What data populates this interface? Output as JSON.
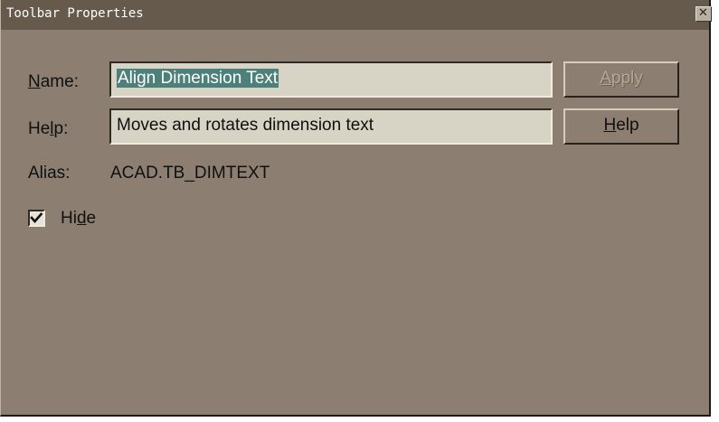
{
  "window": {
    "title": "Toolbar Properties",
    "close_glyph": "✕"
  },
  "form": {
    "name_label_accel": "N",
    "name_label_rest": "ame:",
    "name_value": "Align Dimension Text",
    "help_label_pre": "He",
    "help_label_accel": "l",
    "help_label_post": "p:",
    "help_value": "Moves and rotates dimension text",
    "alias_label": "Alias:",
    "alias_value": "ACAD.TB_DIMTEXT",
    "hide_label_pre": "Hi",
    "hide_label_accel": "d",
    "hide_label_post": "e",
    "hide_checked": true
  },
  "buttons": {
    "apply_accel": "A",
    "apply_rest": "pply",
    "apply_enabled": false,
    "help_accel": "H",
    "help_rest": "elp"
  },
  "colors": {
    "dialog_face": "#8c7f71",
    "titlebar": "#655a4c",
    "field_bg": "#d7d3c5",
    "selection": "#4d7f7b"
  },
  "icons": {
    "close": "close-icon",
    "check": "checkmark-icon"
  }
}
